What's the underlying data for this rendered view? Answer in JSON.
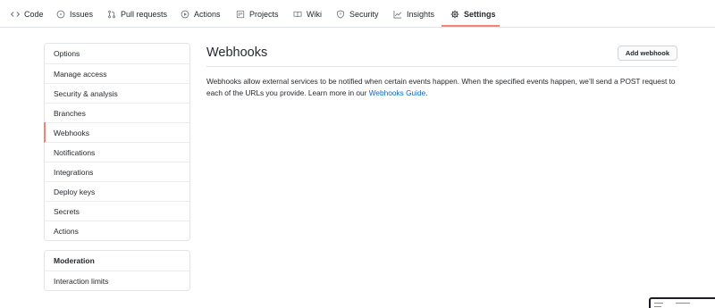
{
  "tabs": [
    {
      "label": "Code",
      "icon": "code-icon",
      "active": false
    },
    {
      "label": "Issues",
      "icon": "issue-opened-icon",
      "active": false
    },
    {
      "label": "Pull requests",
      "icon": "git-pull-request-icon",
      "active": false
    },
    {
      "label": "Actions",
      "icon": "play-icon",
      "active": false
    },
    {
      "label": "Projects",
      "icon": "project-icon",
      "active": false
    },
    {
      "label": "Wiki",
      "icon": "book-icon",
      "active": false
    },
    {
      "label": "Security",
      "icon": "shield-icon",
      "active": false
    },
    {
      "label": "Insights",
      "icon": "graph-icon",
      "active": false
    },
    {
      "label": "Settings",
      "icon": "gear-icon",
      "active": true
    }
  ],
  "sidebar": {
    "items": [
      {
        "label": "Options",
        "selected": false
      },
      {
        "label": "Manage access",
        "selected": false
      },
      {
        "label": "Security & analysis",
        "selected": false
      },
      {
        "label": "Branches",
        "selected": false
      },
      {
        "label": "Webhooks",
        "selected": true
      },
      {
        "label": "Notifications",
        "selected": false
      },
      {
        "label": "Integrations",
        "selected": false
      },
      {
        "label": "Deploy keys",
        "selected": false
      },
      {
        "label": "Secrets",
        "selected": false
      },
      {
        "label": "Actions",
        "selected": false
      }
    ],
    "moderation": {
      "heading": "Moderation",
      "items": [
        {
          "label": "Interaction limits"
        }
      ]
    }
  },
  "main": {
    "title": "Webhooks",
    "add_button": "Add webhook",
    "description": "Webhooks allow external services to be notified when certain events happen. When the specified events happen, we’ll send a POST request to each of the URLs you provide. Learn more in our ",
    "guide_link": "Webhooks Guide",
    "description_end": "."
  },
  "colors": {
    "accent": "#f9826c",
    "link": "#0366d6",
    "border": "#e1e4e8",
    "text": "#24292e"
  }
}
